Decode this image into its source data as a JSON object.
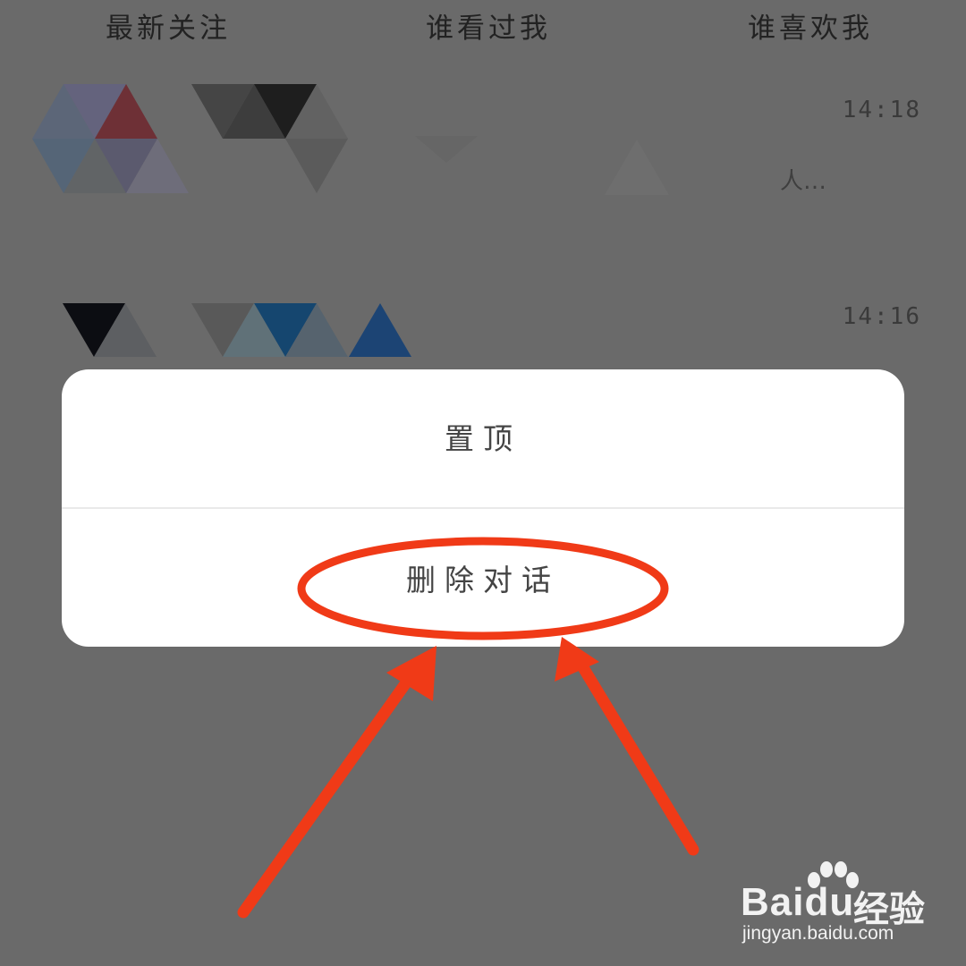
{
  "tabs": [
    {
      "label": "最新关注"
    },
    {
      "label": "谁看过我"
    },
    {
      "label": "谁喜欢我"
    }
  ],
  "conversations": [
    {
      "time": "14:18",
      "snippet": "人…"
    },
    {
      "time": "14:16"
    }
  ],
  "action_sheet": {
    "pin_label": "置顶",
    "delete_label": "删除对话"
  },
  "watermark": {
    "logo": "Baidu",
    "brand_cn": "经验",
    "url": "jingyan.baidu.com"
  },
  "colors": {
    "annotation": "#f03a17",
    "overlay": "#6a6a6a"
  }
}
